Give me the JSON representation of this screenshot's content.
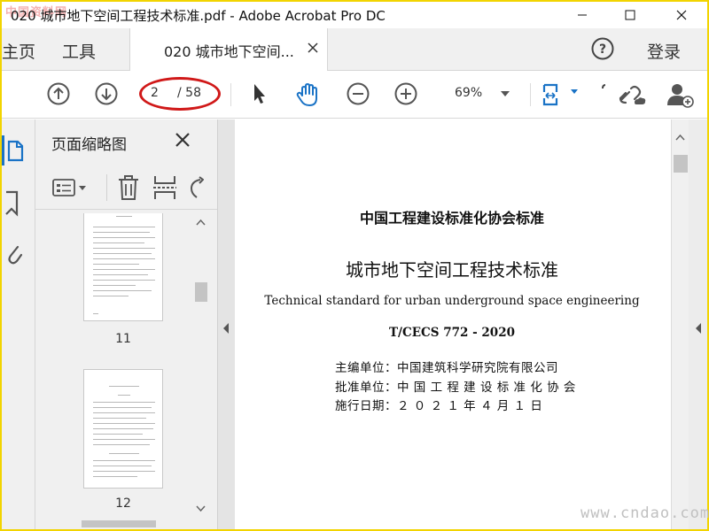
{
  "window": {
    "title": "020 城市地下空间工程技术标准.pdf - Adobe Acrobat Pro DC",
    "watermark_logo": "中国资料网"
  },
  "tabs": {
    "home": "主页",
    "tools": "工具",
    "document": "020 城市地下空间...",
    "login": "登录"
  },
  "toolbar": {
    "current_page": "2",
    "total_pages": "/ 58",
    "zoom": "69%"
  },
  "thumbnail_panel": {
    "title": "页面缩略图",
    "thumbnails": [
      {
        "page_label": "11"
      },
      {
        "page_label": "12"
      }
    ]
  },
  "page": {
    "org_title": "中国工程建设标准化协会标准",
    "title_cn": "城市地下空间工程技术标准",
    "title_en": "Technical standard for urban underground space engineering",
    "code": "T/CECS 772 - 2020",
    "editor_line": "主编单位：中国建筑科学研究院有限公司",
    "approver_line": "批准单位：中 国 工 程 建 设 标 准 化 协 会",
    "date_line": "施行日期：２ ０ ２ １ 年  ４  月  １  日"
  },
  "watermark": "www.cndao.com",
  "colors": {
    "accent_blue": "#1a73c6",
    "annotation_red": "#d01818",
    "frame_yellow": "#f2d400"
  }
}
